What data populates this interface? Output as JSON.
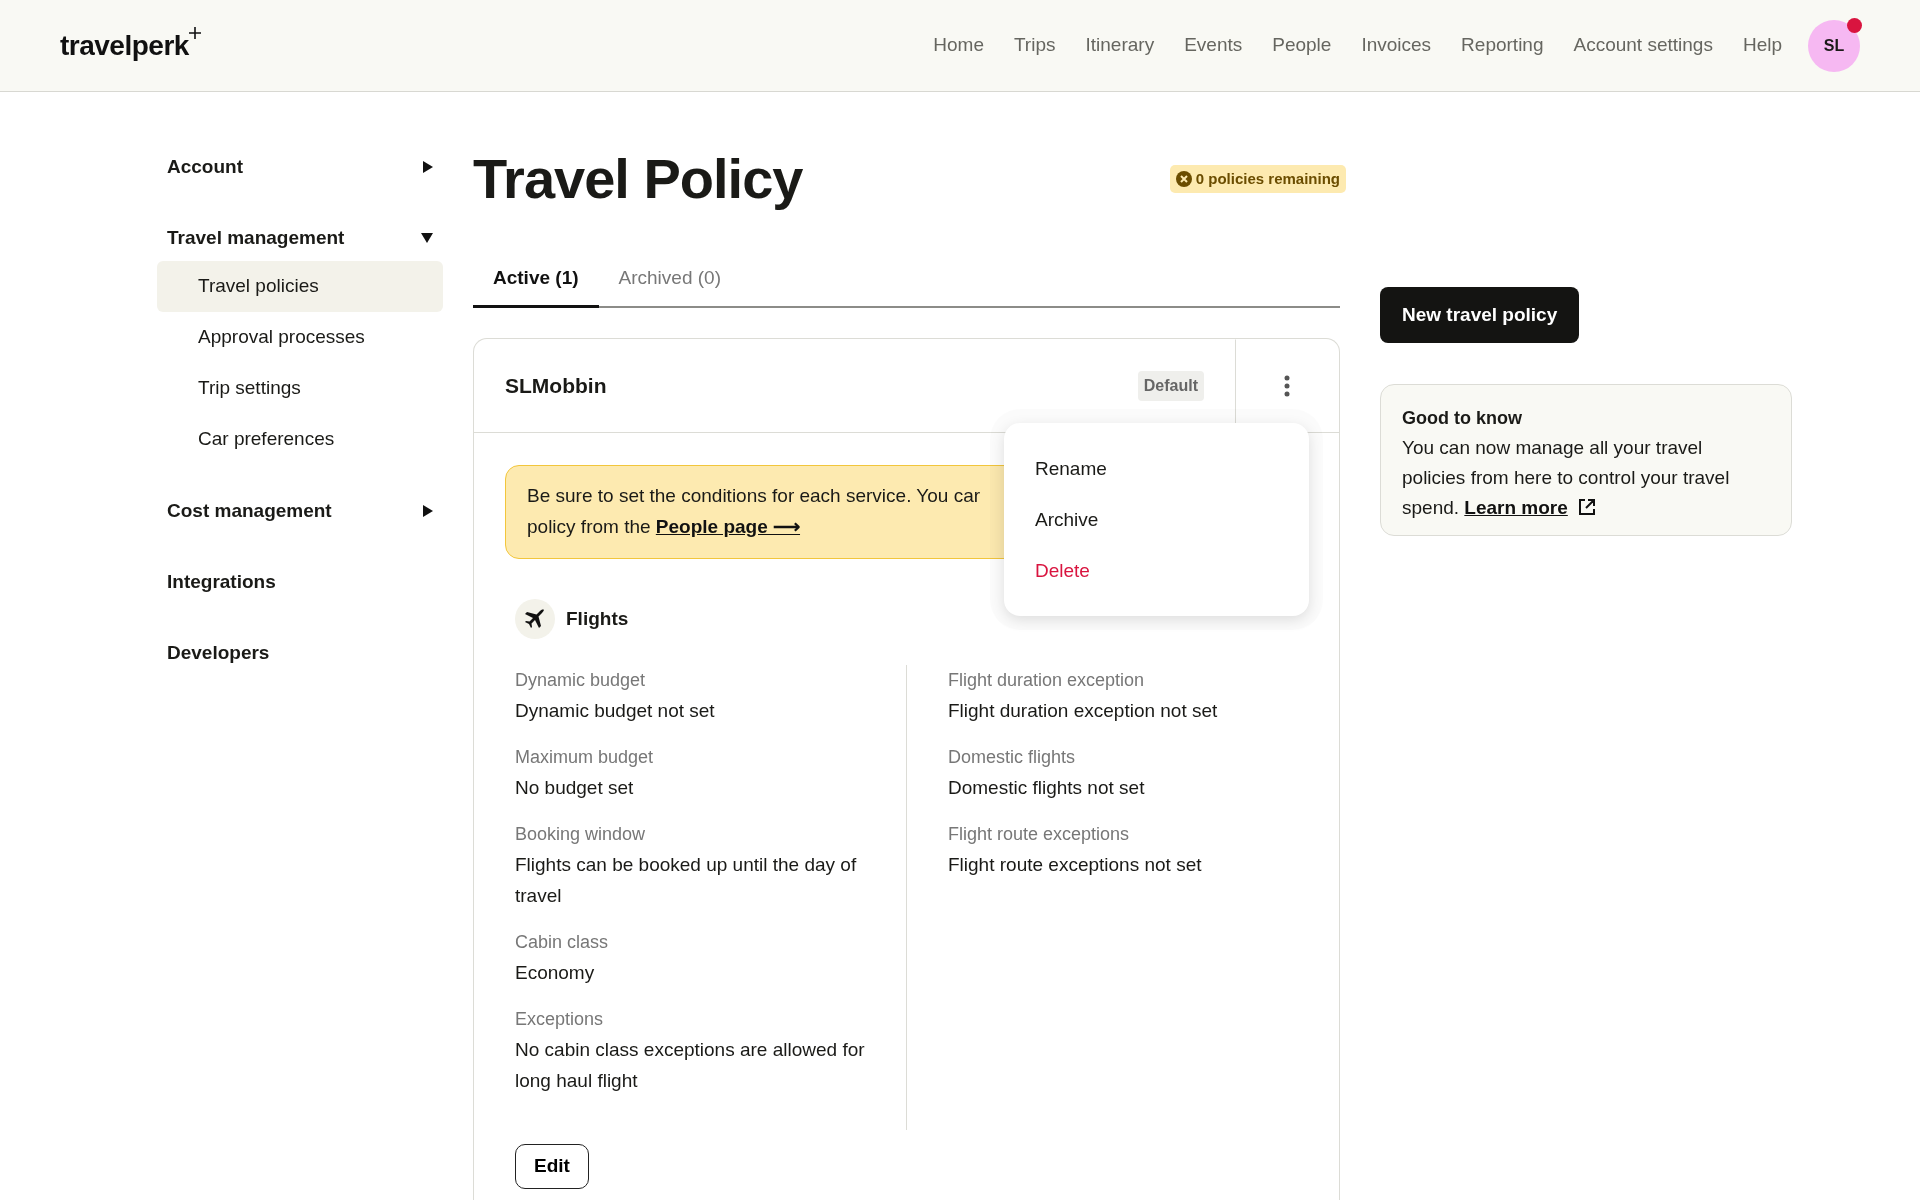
{
  "header": {
    "logo": "travelperk",
    "nav": [
      {
        "label": "Home"
      },
      {
        "label": "Trips"
      },
      {
        "label": "Itinerary"
      },
      {
        "label": "Events"
      },
      {
        "label": "People"
      },
      {
        "label": "Invoices"
      },
      {
        "label": "Reporting"
      },
      {
        "label": "Account settings"
      },
      {
        "label": "Help"
      }
    ],
    "avatar": {
      "initials": "SL",
      "notification": true
    }
  },
  "sidebar": [
    {
      "label": "Account",
      "kind": "group",
      "expanded": false
    },
    {
      "label": "Travel management",
      "kind": "group",
      "expanded": true,
      "children": [
        {
          "label": "Travel policies",
          "selected": true
        },
        {
          "label": "Approval processes",
          "selected": false
        },
        {
          "label": "Trip settings",
          "selected": false
        },
        {
          "label": "Car preferences",
          "selected": false
        }
      ]
    },
    {
      "label": "Cost management",
      "kind": "group",
      "expanded": false
    },
    {
      "label": "Integrations",
      "kind": "link"
    },
    {
      "label": "Developers",
      "kind": "link"
    }
  ],
  "title": "Travel Policy",
  "remaining_badge": "0 policies remaining",
  "tabs": [
    {
      "label": "Active (1)",
      "selected": true
    },
    {
      "label": "Archived (0)",
      "selected": false
    }
  ],
  "policy_card": {
    "name": "SLMobbin",
    "badge": "Default",
    "alert": {
      "line_1": "Be sure to set the conditions for each service. You car",
      "line_2": "policy from the ",
      "link": "People page ⟶"
    },
    "menu": [
      {
        "label": "Rename",
        "kind": "normal"
      },
      {
        "label": "Archive",
        "kind": "normal"
      },
      {
        "label": "Delete",
        "kind": "danger"
      }
    ],
    "service": "Flights",
    "left_fields": [
      {
        "label": "Dynamic budget",
        "value": "Dynamic budget not set"
      },
      {
        "label": "Maximum budget",
        "value": "No budget set"
      },
      {
        "label": "Booking window",
        "value": "Flights can be booked up until the day of travel"
      },
      {
        "label": "Cabin class",
        "value": "Economy"
      },
      {
        "label": "Exceptions",
        "value": "No cabin class exceptions are allowed for long haul flight"
      }
    ],
    "right_fields": [
      {
        "label": "Flight duration exception",
        "value": "Flight duration exception not set"
      },
      {
        "label": "Domestic flights",
        "value": "Domestic flights not set"
      },
      {
        "label": "Flight route exceptions",
        "value": "Flight route exceptions not set"
      }
    ],
    "edit_button": "Edit"
  },
  "new_button": "New travel policy",
  "info_card": {
    "title": "Good to know",
    "text": "You can now manage all your travel policies from here to control your travel spend. ",
    "link": "Learn more"
  }
}
